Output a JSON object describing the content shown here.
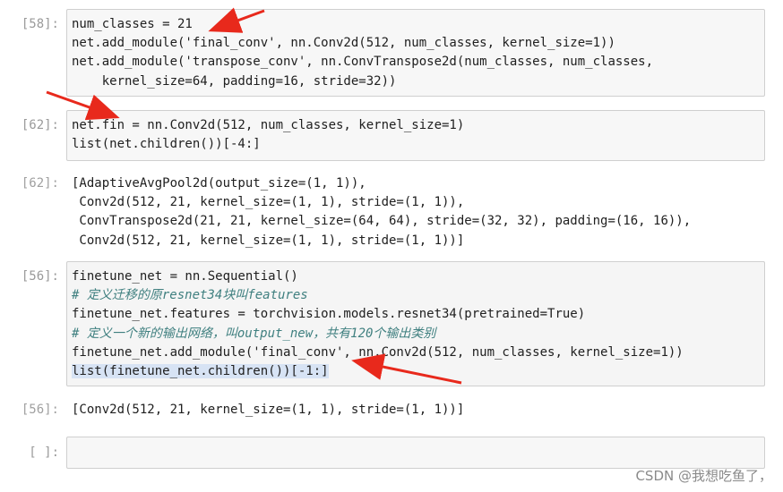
{
  "cells": [
    {
      "prompt": "[58]:",
      "lines": [
        "num_classes = 21",
        "net.add_module('final_conv', nn.Conv2d(512, num_classes, kernel_size=1))",
        "net.add_module('transpose_conv', nn.ConvTranspose2d(num_classes, num_classes,",
        "    kernel_size=64, padding=16, stride=32))"
      ]
    },
    {
      "prompt": "[62]:",
      "lines": [
        "net.fin = nn.Conv2d(512, num_classes, kernel_size=1)",
        "list(net.children())[-4:]"
      ]
    },
    {
      "prompt": "[62]:",
      "output": true,
      "lines": [
        "[AdaptiveAvgPool2d(output_size=(1, 1)),",
        " Conv2d(512, 21, kernel_size=(1, 1), stride=(1, 1)),",
        " ConvTranspose2d(21, 21, kernel_size=(64, 64), stride=(32, 32), padding=(16, 16)),",
        " Conv2d(512, 21, kernel_size=(1, 1), stride=(1, 1))]"
      ]
    },
    {
      "prompt": "[56]:",
      "lines": [
        "finetune_net = nn.Sequential()",
        "# 定义迁移的原resnet34块叫features",
        "finetune_net.features = torchvision.models.resnet34(pretrained=True)",
        "# 定义一个新的输出网络，叫output_new，共有120个输出类别",
        "finetune_net.add_module('final_conv', nn.Conv2d(512, num_classes, kernel_size=1))",
        "list(finetune_net.children())[-1:]"
      ]
    },
    {
      "prompt": "[56]:",
      "output": true,
      "lines": [
        "[Conv2d(512, 21, kernel_size=(1, 1), stride=(1, 1))]"
      ]
    },
    {
      "prompt": "[ ]:",
      "lines": []
    }
  ],
  "watermark": "CSDN @我想吃鱼了，",
  "colors": {
    "arrow": "#e8291c",
    "cell_bg": "#f7f7f7",
    "prompt": "#9a9a9a"
  }
}
